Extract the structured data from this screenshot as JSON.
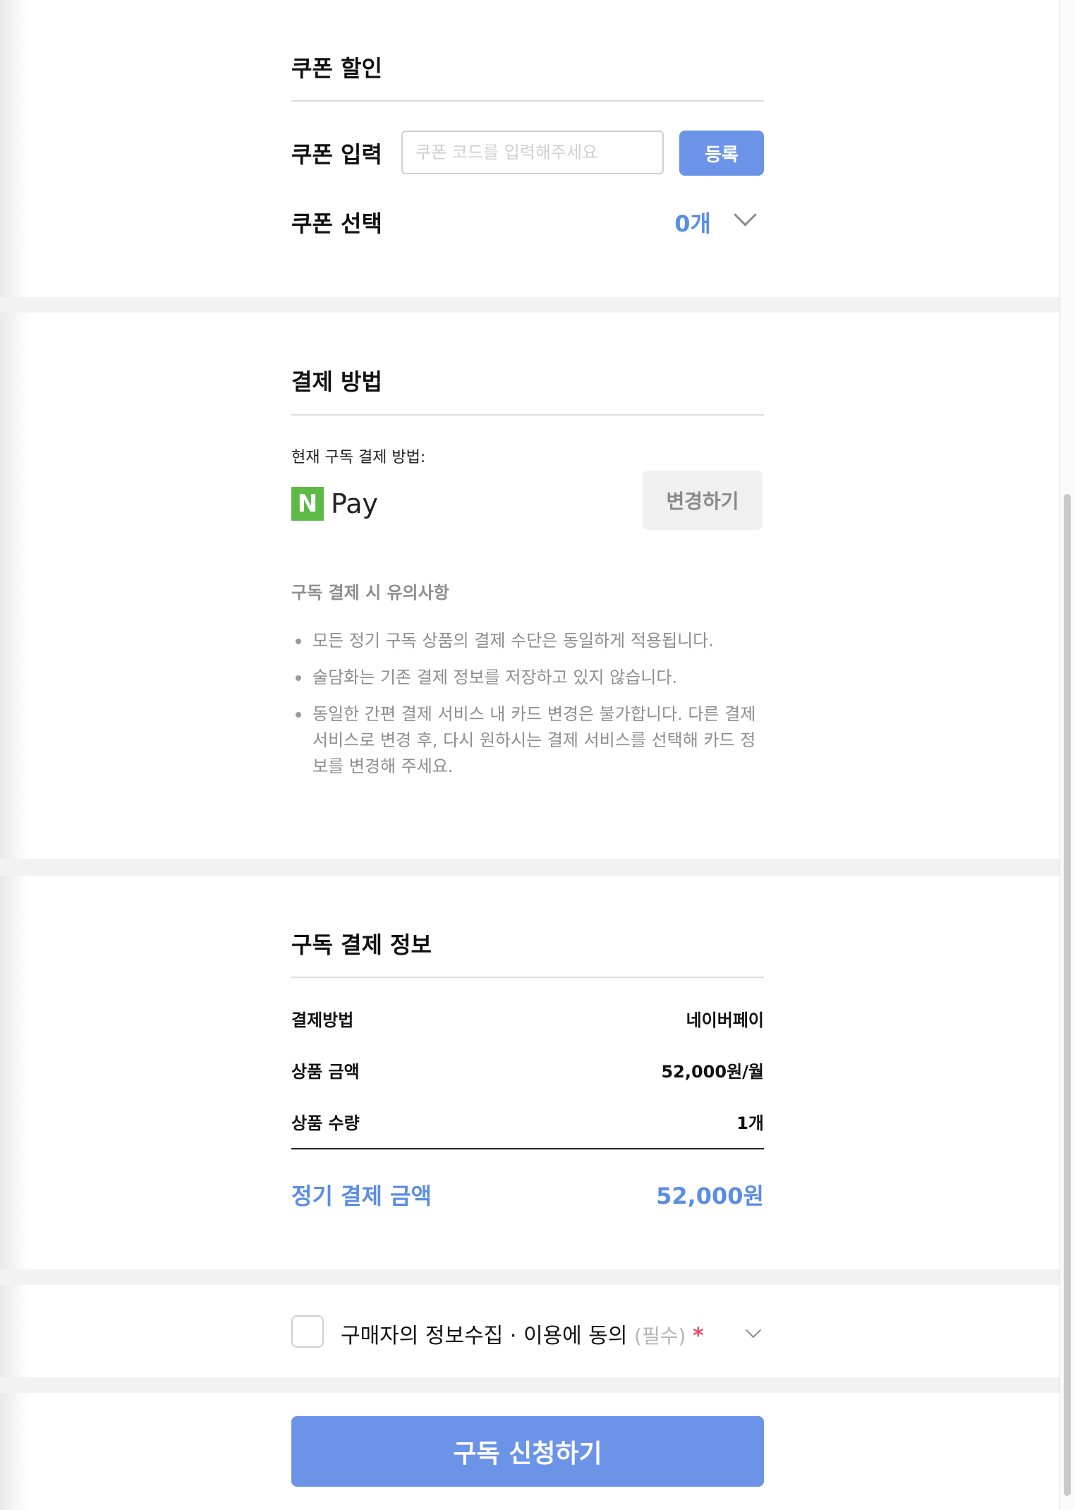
{
  "coupon": {
    "section_title": "쿠폰 할인",
    "input_label": "쿠폰 입력",
    "input_placeholder": "쿠폰 코드를 입력해주세요",
    "register_button": "등록",
    "select_label": "쿠폰 선택",
    "select_count": "0개"
  },
  "payment": {
    "section_title": "결제 방법",
    "current_label": "현재 구독 결제 방법:",
    "method_logo_letter": "N",
    "method_name": "Pay",
    "change_button": "변경하기",
    "notice_title": "구독 결제 시 유의사항",
    "notices": [
      "모든 정기 구독 상품의 결제 수단은 동일하게 적용됩니다.",
      "술담화는 기존 결제 정보를 저장하고 있지 않습니다.",
      "동일한 간편 결제 서비스 내 카드 변경은 불가합니다. 다른 결제 서비스로 변경 후, 다시 원하시는 결제 서비스를 선택해 카드 정보를 변경해 주세요."
    ]
  },
  "summary": {
    "section_title": "구독 결제 정보",
    "rows": [
      {
        "label": "결제방법",
        "value": "네이버페이"
      },
      {
        "label": "상품 금액",
        "value": "52,000원/월"
      },
      {
        "label": "상품 수량",
        "value": "1개"
      }
    ],
    "total_label": "정기 결제 금액",
    "total_value": "52,000원"
  },
  "agreement": {
    "text": "구매자의 정보수집 · 이용에 동의",
    "required": "(필수)",
    "star": "*"
  },
  "submit_button": "구독 신청하기",
  "colors": {
    "accent": "#6b93e8",
    "accent_text": "#5b8de3",
    "npay_green": "#5dba46",
    "required_star": "#e64b63",
    "section_band": "#f2f2f2"
  },
  "icons": {
    "coupon_dropdown": "chevron-down-icon",
    "agreement_expand": "chevron-down-icon",
    "payment_logo": "naver-pay-logo"
  }
}
